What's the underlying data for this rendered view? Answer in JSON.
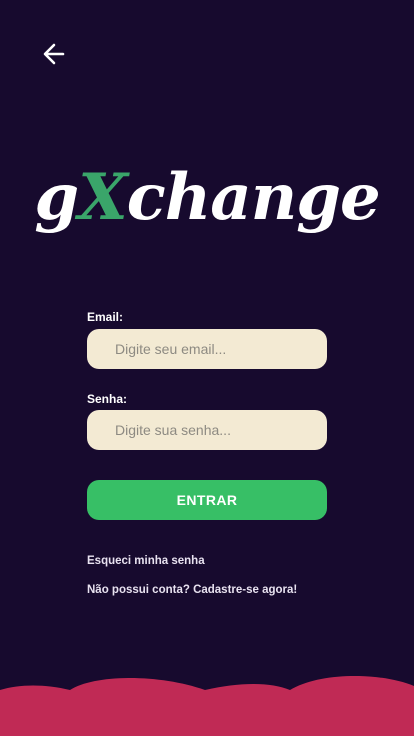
{
  "header": {
    "back_icon": "arrow-left-icon"
  },
  "logo": {
    "part1": "g",
    "part2": "X",
    "part3": "change"
  },
  "form": {
    "email_label": "Email:",
    "email_placeholder": "Digite seu email...",
    "password_label": "Senha:",
    "password_placeholder": "Digite sua senha...",
    "submit_label": "ENTRAR"
  },
  "links": {
    "forgot_password": "Esqueci minha senha",
    "signup": "Não possui conta? Cadastre-se agora!"
  },
  "colors": {
    "background": "#170a2e",
    "input_bg": "#f3ead3",
    "button": "#37bf66",
    "accent_x": "#3aa56a",
    "waves": "#c02a55"
  }
}
